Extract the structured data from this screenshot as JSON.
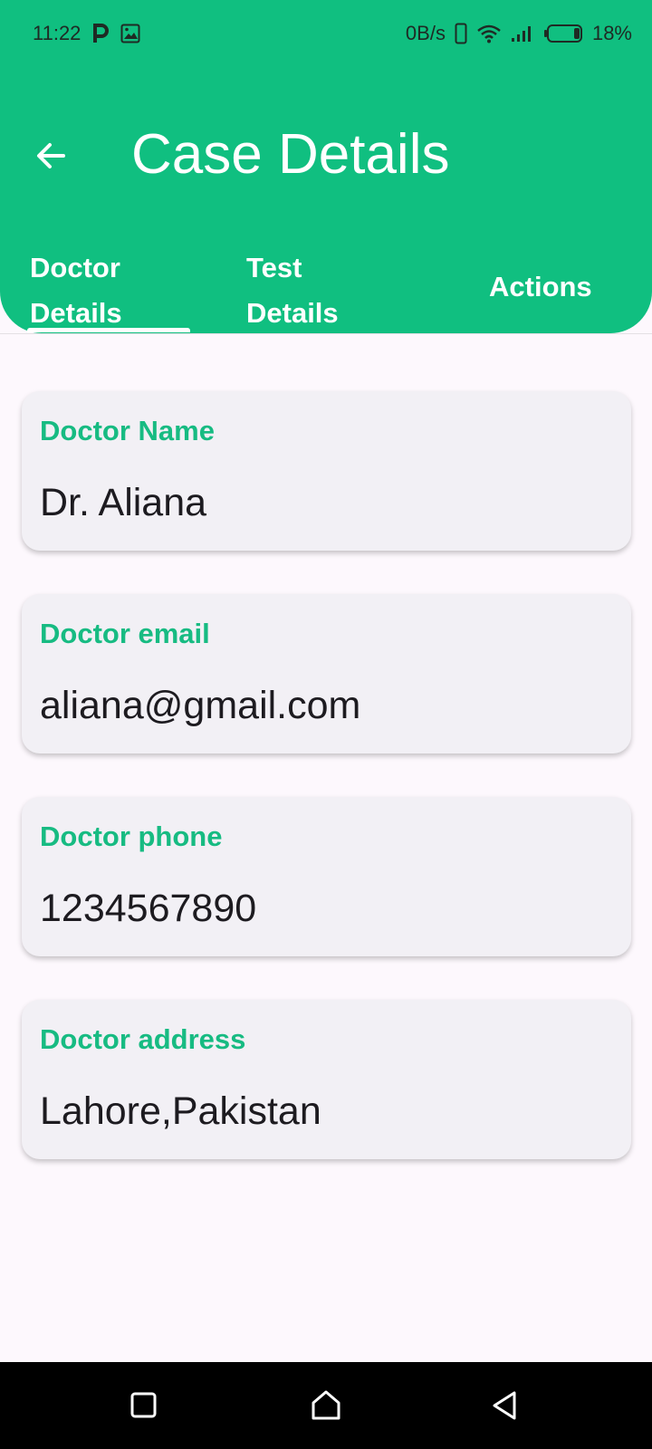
{
  "status_bar": {
    "time": "11:22",
    "network_speed": "0B/s",
    "battery_percent": "18%",
    "icons": [
      "parking-notification-icon",
      "image-notification-icon",
      "vibrate-icon",
      "wifi-icon",
      "signal-icon",
      "battery-icon"
    ]
  },
  "header": {
    "title": "Case Details",
    "background_color": "#10bf80"
  },
  "tabs": [
    {
      "label": "Doctor\nDetails",
      "selected": true
    },
    {
      "label": "Test\nDetails",
      "selected": false
    },
    {
      "label": "Actions",
      "selected": false
    }
  ],
  "fields": [
    {
      "label": "Doctor Name",
      "value": "Dr. Aliana"
    },
    {
      "label": "Doctor email",
      "value": "aliana@gmail.com"
    },
    {
      "label": "Doctor phone",
      "value": "1234567890"
    },
    {
      "label": "Doctor address",
      "value": "Lahore,Pakistan"
    }
  ],
  "colors": {
    "accent": "#10bf80",
    "label": "#17bb82",
    "card_background": "#f2f0f5"
  },
  "nav_bar": {
    "icons": [
      "recents-square-icon",
      "home-icon",
      "back-triangle-icon"
    ]
  }
}
